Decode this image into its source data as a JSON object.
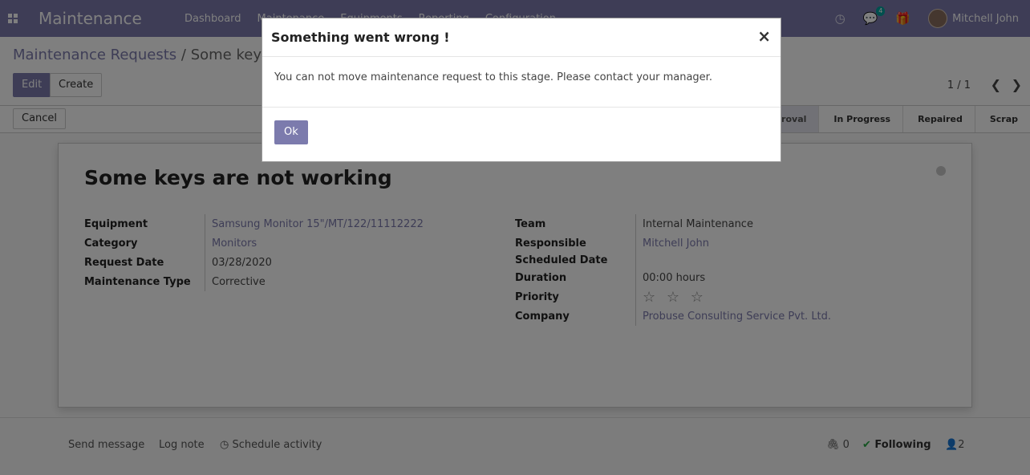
{
  "navbar": {
    "app_name": "Maintenance",
    "menu": [
      "Dashboard",
      "Maintenance",
      "Equipments",
      "Reporting",
      "Configuration"
    ],
    "messages_count": "4",
    "user_name": "Mitchell John"
  },
  "control_panel": {
    "breadcrumb_parent": "Maintenance Requests",
    "breadcrumb_sep": "/",
    "breadcrumb_current": "Some keys are not working",
    "edit_label": "Edit",
    "create_label": "Create",
    "pager": "1 / 1"
  },
  "statusbar": {
    "cancel_label": "Cancel",
    "stages": [
      "Pending Approval",
      "In Progress",
      "Repaired",
      "Scrap"
    ],
    "active_stage": "Pending Approval"
  },
  "record": {
    "title": "Some keys are not working",
    "left_fields": [
      {
        "label": "Equipment",
        "value": "Samsung Monitor 15\"/MT/122/11112222",
        "link": true
      },
      {
        "label": "Category",
        "value": "Monitors",
        "link": true
      },
      {
        "label": "Request Date",
        "value": "03/28/2020",
        "link": false
      },
      {
        "label": "Maintenance Type",
        "value": "Corrective",
        "link": false
      }
    ],
    "right_fields": [
      {
        "label": "Team",
        "value": "Internal Maintenance",
        "link": false
      },
      {
        "label": "Responsible",
        "value": "Mitchell John",
        "link": true
      },
      {
        "label": "Scheduled Date",
        "value": "",
        "link": false
      },
      {
        "label": "Duration",
        "value": "00:00  hours",
        "link": false
      },
      {
        "label": "Priority",
        "value": "☆ ☆ ☆",
        "link": false
      },
      {
        "label": "Company",
        "value": "Probuse Consulting Service Pvt. Ltd.",
        "link": true
      }
    ],
    "priority_stars": 0
  },
  "chatter": {
    "send_message": "Send message",
    "log_note": "Log note",
    "schedule_activity": "Schedule activity",
    "attachments_count": "0",
    "following_label": "Following",
    "followers_count": "2"
  },
  "modal": {
    "title": "Something went wrong !",
    "close_label": "×",
    "message": "You can not move maintenance request to this stage. Please contact your manager.",
    "ok_label": "Ok"
  }
}
